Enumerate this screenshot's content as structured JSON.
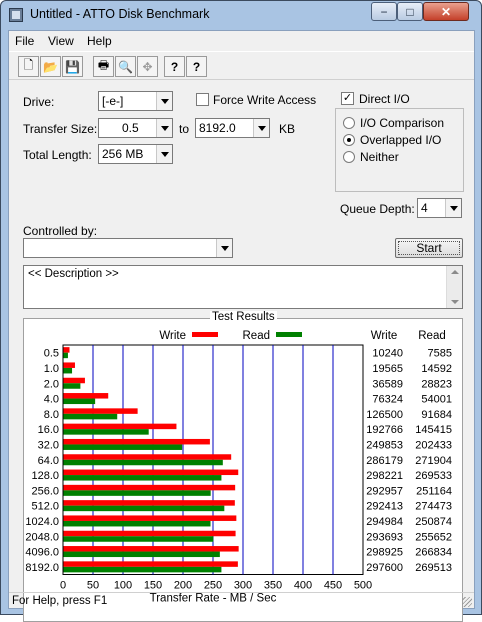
{
  "window": {
    "title": "Untitled - ATTO Disk Benchmark",
    "min_glyph": "−",
    "max_glyph": "□",
    "close_glyph": "✕"
  },
  "menu": [
    "File",
    "View",
    "Help"
  ],
  "toolbar": {
    "icons": [
      {
        "name": "new-document-icon",
        "glyph": "🗋"
      },
      {
        "name": "open-folder-icon",
        "glyph": "📂"
      },
      {
        "name": "save-icon",
        "glyph": "💾"
      },
      {
        "name": "print-icon",
        "glyph": "🖶"
      },
      {
        "name": "print-preview-icon",
        "glyph": "🔍"
      },
      {
        "name": "move-icon",
        "glyph": "✥"
      },
      {
        "name": "help-icon",
        "glyph": "?"
      },
      {
        "name": "context-help-icon",
        "glyph": "?"
      }
    ]
  },
  "settings": {
    "drive_label": "Drive:",
    "drive_value": "[-e-]",
    "force_write_label": "Force Write Access",
    "force_write_checked": false,
    "direct_io_label": "Direct I/O",
    "direct_io_checked": true,
    "transfer_size_label": "Transfer Size:",
    "transfer_from": "0.5",
    "to_label": "to",
    "transfer_to": "8192.0",
    "kb_label": "KB",
    "total_length_label": "Total Length:",
    "total_length_value": "256 MB",
    "io_options": [
      {
        "label": "I/O Comparison",
        "selected": false
      },
      {
        "label": "Overlapped I/O",
        "selected": true
      },
      {
        "label": "Neither",
        "selected": false
      }
    ],
    "queue_depth_label": "Queue Depth:",
    "queue_depth_value": "4",
    "controlled_by_label": "Controlled by:",
    "controlled_by_value": "",
    "start_label": "Start",
    "description": "<< Description >>"
  },
  "results": {
    "title": "Test Results",
    "write_legend": "Write",
    "read_legend": "Read",
    "write_header": "Write",
    "read_header": "Read",
    "write_color": "#ff0000",
    "read_color": "#008000",
    "grid_color": "#0000c0"
  },
  "chart_data": {
    "type": "bar",
    "orientation": "horizontal",
    "categories": [
      "0.5",
      "1.0",
      "2.0",
      "4.0",
      "8.0",
      "16.0",
      "32.0",
      "64.0",
      "128.0",
      "256.0",
      "512.0",
      "1024.0",
      "2048.0",
      "4096.0",
      "8192.0"
    ],
    "series": [
      {
        "name": "Write",
        "values": [
          10240,
          19565,
          36589,
          76324,
          126500,
          192766,
          249853,
          286179,
          298221,
          292957,
          292413,
          294984,
          293693,
          298925,
          297600
        ]
      },
      {
        "name": "Read",
        "values": [
          7585,
          14592,
          28823,
          54001,
          91684,
          145415,
          202433,
          271904,
          269533,
          251164,
          274473,
          250874,
          255652,
          266834,
          269513
        ]
      }
    ],
    "x_ticks": [
      "0",
      "50",
      "100",
      "150",
      "200",
      "250",
      "300",
      "350",
      "400",
      "450",
      "500"
    ],
    "xlim": [
      0,
      500
    ],
    "xlabel": "Transfer Rate - MB / Sec",
    "grid": true,
    "legend": "top"
  },
  "status": {
    "text": "For Help, press F1"
  }
}
